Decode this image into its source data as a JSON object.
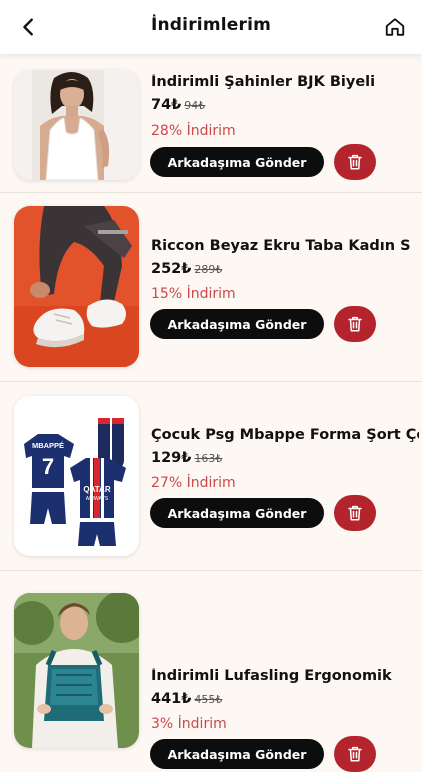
{
  "header": {
    "title": "İndirimlerim",
    "back_icon": "chevron-left-icon",
    "home_icon": "home-icon"
  },
  "items": [
    {
      "name": "İndirimli Şahinler BJK Biyeli",
      "price": "74₺",
      "old_price": "94₺",
      "discount": "28% İndirim",
      "send_label": "Arkadaşıma Gönder",
      "image": "woman-white-tank-top-photo"
    },
    {
      "name": "Riccon Beyaz Ekru Taba Kadın S",
      "price": "252₺",
      "old_price": "289₺",
      "discount": "15% İndirim",
      "send_label": "Arkadaşıma Gönder",
      "image": "white-sneakers-photo"
    },
    {
      "name": "Çocuk Psg Mbappe Forma Şort Ço",
      "price": "129₺",
      "old_price": "163₺",
      "discount": "27% İndirim",
      "send_label": "Arkadaşıma Gönder",
      "image": "psg-kit-photo",
      "jersey_text": {
        "name": "MBAPPÉ",
        "number": "7",
        "sponsor": "QATAR",
        "sponsor_sub": "AIRWAYS"
      }
    },
    {
      "name": "İndirimli Lufasling Ergonomik",
      "price": "441₺",
      "old_price": "455₺",
      "discount": "3% İndirim",
      "send_label": "Arkadaşıma Gönder",
      "image": "baby-carrier-photo"
    }
  ],
  "colors": {
    "accent_red": "#b3242c",
    "discount_red": "#c84a4a",
    "button_black": "#0d0d0d",
    "background": "#fdf8f3"
  }
}
